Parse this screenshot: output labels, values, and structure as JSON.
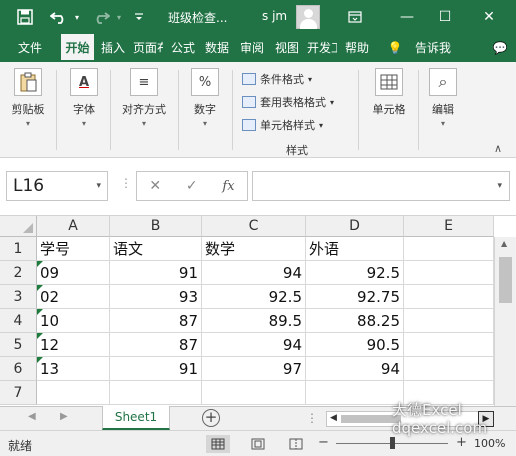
{
  "titlebar": {
    "save_icon": "save-icon",
    "undo_icon": "undo-icon",
    "redo_icon": "redo-icon",
    "customize_icon": "customize-quick-access-icon",
    "title": "班级检查...",
    "user": "s jm",
    "ribbon_display_icon": "ribbon-display-options-icon",
    "minimize": "—",
    "restore": "☐",
    "close": "✕"
  },
  "tabs": [
    {
      "label": "文件"
    },
    {
      "label": "开始"
    },
    {
      "label": "插入"
    },
    {
      "label": "页面布局"
    },
    {
      "label": "公式"
    },
    {
      "label": "数据"
    },
    {
      "label": "审阅"
    },
    {
      "label": "视图"
    },
    {
      "label": "开发工具"
    },
    {
      "label": "帮助"
    },
    {
      "label": "💡"
    },
    {
      "label": "告诉我"
    },
    {
      "label": "💬"
    }
  ],
  "ribbon": {
    "clipboard": {
      "label": "剪贴板",
      "icon": "clipboard-icon"
    },
    "font": {
      "label": "字体",
      "icon": "font-icon",
      "glyph": "A"
    },
    "alignment": {
      "label": "对齐方式",
      "icon": "align-icon",
      "glyph": "≡"
    },
    "number": {
      "label": "数字",
      "icon": "percent-icon",
      "glyph": "%"
    },
    "styles": {
      "conditional": "条件格式",
      "table": "套用表格格式",
      "cell_styles": "单元格样式",
      "group_label": "样式"
    },
    "cells": {
      "label": "单元格",
      "icon": "cells-icon"
    },
    "editing": {
      "label": "编辑",
      "icon": "search-edit-icon",
      "glyph": "⌕"
    },
    "collapse_glyph": "∧"
  },
  "formula_bar": {
    "name_box": "L16",
    "cancel": "✕",
    "enter": "✓",
    "fx": "fx",
    "formula": ""
  },
  "grid": {
    "columns": [
      "A",
      "B",
      "C",
      "D",
      "E"
    ],
    "rows": [
      "1",
      "2",
      "3",
      "4",
      "5",
      "6",
      "7"
    ],
    "data": [
      [
        "学号",
        "语文",
        "数学",
        "外语",
        ""
      ],
      [
        "09",
        "91",
        "94",
        "92.5",
        ""
      ],
      [
        "02",
        "93",
        "92.5",
        "92.75",
        ""
      ],
      [
        "10",
        "87",
        "89.5",
        "88.25",
        ""
      ],
      [
        "12",
        "87",
        "94",
        "90.5",
        ""
      ],
      [
        "13",
        "91",
        "97",
        "94",
        ""
      ],
      [
        "",
        "",
        "",
        "",
        ""
      ]
    ]
  },
  "sheets": {
    "active": "Sheet1",
    "add_glyph": "+",
    "more": "⋮"
  },
  "status": {
    "ready": "就绪",
    "zoom": "100%"
  },
  "watermark": {
    "line1": "大德Excel",
    "line2": "dqexcel.com"
  },
  "colors": {
    "excel_green": "#217346",
    "ribbon_bg": "#f3f3f3"
  }
}
